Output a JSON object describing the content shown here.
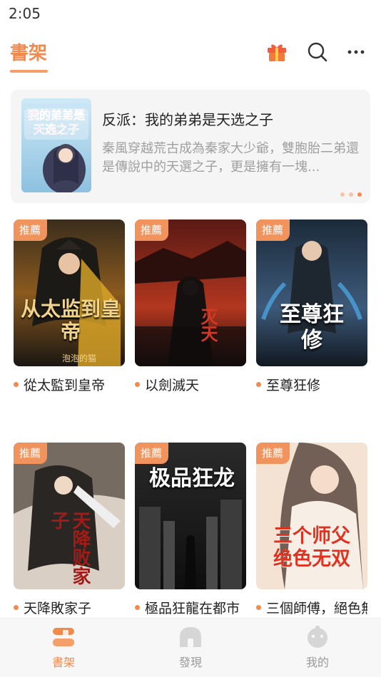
{
  "status_bar": {
    "time": "2:05"
  },
  "header": {
    "title": "書架",
    "icons": [
      "gift-icon",
      "search-icon",
      "more-icon"
    ],
    "accent_color": "#f28a4e"
  },
  "banner": {
    "title": "反派：我的弟弟是天选之子",
    "description": "秦風穿越荒古成為秦家大少爺，雙胞胎二弟還是傳說中的天選之子，更是擁有一塊...",
    "cover_text": "我的弟弟是天选之子",
    "pagination": {
      "count": 3,
      "active_index": 2
    }
  },
  "books": [
    {
      "badge": "推薦",
      "title": "從太監到皇帝",
      "cover_text": "从太监到皇帝",
      "cover_author": "泡泡的猫"
    },
    {
      "badge": "推薦",
      "title": "以劍滅天",
      "cover_text": "灭天"
    },
    {
      "badge": "推薦",
      "title": "至尊狂修",
      "cover_text": "至尊狂修"
    },
    {
      "badge": "推薦",
      "title": "天降敗家子",
      "cover_text": "天降败家子"
    },
    {
      "badge": "推薦",
      "title": "極品狂龍在都市",
      "cover_text": "极品狂龙"
    },
    {
      "badge": "推薦",
      "title": "三個師傅，絕色無雙",
      "cover_text": "三个师父 绝色无双"
    }
  ],
  "tabbar": {
    "items": [
      {
        "label": "書架",
        "icon": "bookshelf-icon",
        "active": true
      },
      {
        "label": "發現",
        "icon": "discover-icon",
        "active": false
      },
      {
        "label": "我的",
        "icon": "profile-icon",
        "active": false
      }
    ]
  }
}
